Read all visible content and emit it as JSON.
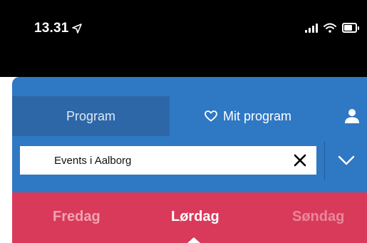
{
  "status_bar": {
    "time": "13.31",
    "icons": [
      "location-arrow-icon",
      "signal-icon",
      "wifi-icon",
      "battery-icon"
    ]
  },
  "tabs": {
    "program_label": "Program",
    "mit_program_label": "Mit program",
    "mit_program_icon": "heart-outline-icon",
    "profile_icon": "user-icon"
  },
  "filter": {
    "value": "Events i Aalborg",
    "clear_icon": "close-icon",
    "expand_icon": "chevron-down-icon"
  },
  "days": {
    "items": [
      "Fredag",
      "Lørdag",
      "Søndag"
    ],
    "selected": "Lørdag"
  },
  "colors": {
    "header_blue": "#2f78c4",
    "active_tab_blue": "#2d67a8",
    "day_bar_red": "#d93a5a",
    "status_bar": "#000000"
  }
}
